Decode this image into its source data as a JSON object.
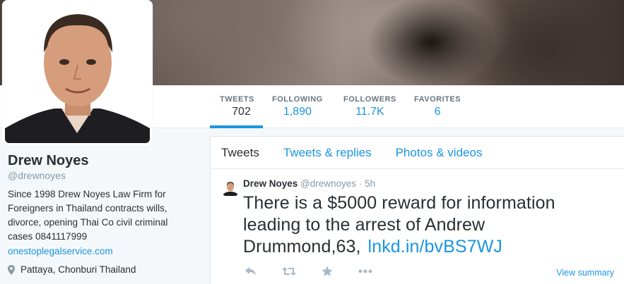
{
  "profile": {
    "name": "Drew Noyes",
    "handle": "@drewnoyes",
    "bio": "Since 1998 Drew Noyes Law Firm for Foreigners in Thailand contracts wills, divorce, opening Thai Co civil criminal cases 0841117999",
    "url": "onestoplegalservice.com",
    "location": "Pattaya, Chonburi Thailand"
  },
  "stats": {
    "tweets": {
      "label": "TWEETS",
      "value": "702"
    },
    "following": {
      "label": "FOLLOWING",
      "value": "1,890"
    },
    "followers": {
      "label": "FOLLOWERS",
      "value": "11.7K"
    },
    "favorites": {
      "label": "FAVORITES",
      "value": "6"
    }
  },
  "tabs": {
    "tweets": "Tweets",
    "replies": "Tweets & replies",
    "photos": "Photos & videos"
  },
  "tweet": {
    "name": "Drew Noyes",
    "handle": "@drewnoyes",
    "separator": "·",
    "time": "5h",
    "text": "There is a $5000 reward for information leading to the arrest of Andrew Drummond,63,",
    "link": "lnkd.in/bvBS7WJ",
    "view_summary": "View summary"
  },
  "icons": {
    "reply": "reply-icon",
    "retweet": "retweet-icon",
    "favorite": "star-icon",
    "more": "more-icon",
    "location": "location-pin-icon"
  },
  "colors": {
    "accent": "#1b95e0",
    "text": "#292f33",
    "muted": "#8899a6",
    "background": "#f5f8fa"
  }
}
